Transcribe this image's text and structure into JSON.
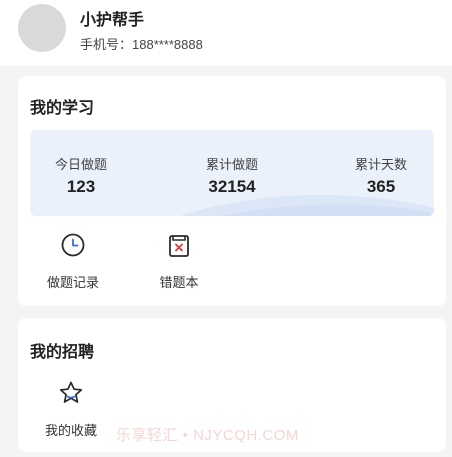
{
  "profile": {
    "name": "小护帮手",
    "phone": "手机号：188****8888"
  },
  "study": {
    "title": "我的学习",
    "stats": [
      {
        "label": "今日做题",
        "value": "123"
      },
      {
        "label": "累计做题",
        "value": "32154"
      },
      {
        "label": "累计天数",
        "value": "365"
      }
    ],
    "tools": [
      {
        "label": "做题记录",
        "icon": "clock-icon"
      },
      {
        "label": "错题本",
        "icon": "wrong-book-icon"
      }
    ]
  },
  "jobs": {
    "title": "我的招聘",
    "tools": [
      {
        "label": "我的收藏",
        "icon": "star-icon"
      }
    ]
  },
  "watermark": "乐享轻汇 • NJYCQH.COM",
  "colors": {
    "accent": "#3b6fd8",
    "error": "#e23d3d",
    "stats_bg": "#eaf1fb"
  }
}
